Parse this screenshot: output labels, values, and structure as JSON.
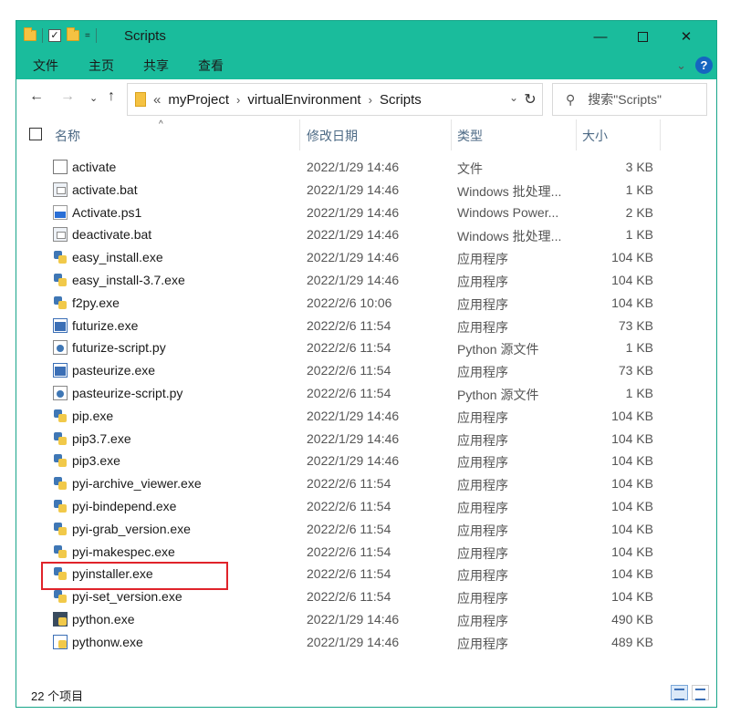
{
  "window": {
    "title": "Scripts",
    "colors": {
      "titlebar": "#1abc9c",
      "highlight": "#e0232a"
    }
  },
  "titlebar": {
    "quick_access": [
      "folder-icon",
      "check-icon",
      "folder-icon"
    ],
    "dropdown": "=",
    "minimize": "—",
    "close": "✕"
  },
  "ribbon": {
    "tabs": [
      {
        "label": "文件",
        "active": true
      },
      {
        "label": "主页"
      },
      {
        "label": "共享"
      },
      {
        "label": "查看"
      }
    ],
    "collapse": "⌄",
    "help": "?"
  },
  "nav": {
    "back": "←",
    "forward": "→",
    "recent": "⌄",
    "up": "↑",
    "breadcrumb_lead": "«",
    "breadcrumb": [
      "myProject",
      "virtualEnvironment",
      "Scripts"
    ],
    "chevron": "›",
    "dropdown": "⌄",
    "refresh": "↻",
    "search_icon": "⚲",
    "search_placeholder": "搜索\"Scripts\""
  },
  "columns": {
    "name": "名称",
    "modified": "修改日期",
    "type": "类型",
    "size": "大小",
    "sort_indicator": "^"
  },
  "files": [
    {
      "name": "activate",
      "date": "2022/1/29 14:46",
      "type": "文件",
      "size": "3 KB",
      "icon": "file"
    },
    {
      "name": "activate.bat",
      "date": "2022/1/29 14:46",
      "type": "Windows 批处理...",
      "size": "1 KB",
      "icon": "bat"
    },
    {
      "name": "Activate.ps1",
      "date": "2022/1/29 14:46",
      "type": "Windows Power...",
      "size": "2 KB",
      "icon": "ps1"
    },
    {
      "name": "deactivate.bat",
      "date": "2022/1/29 14:46",
      "type": "Windows 批处理...",
      "size": "1 KB",
      "icon": "bat"
    },
    {
      "name": "easy_install.exe",
      "date": "2022/1/29 14:46",
      "type": "应用程序",
      "size": "104 KB",
      "icon": "pyexe"
    },
    {
      "name": "easy_install-3.7.exe",
      "date": "2022/1/29 14:46",
      "type": "应用程序",
      "size": "104 KB",
      "icon": "pyexe"
    },
    {
      "name": "f2py.exe",
      "date": "2022/2/6 10:06",
      "type": "应用程序",
      "size": "104 KB",
      "icon": "pyexe"
    },
    {
      "name": "futurize.exe",
      "date": "2022/2/6 11:54",
      "type": "应用程序",
      "size": "73 KB",
      "icon": "win"
    },
    {
      "name": "futurize-script.py",
      "date": "2022/2/6 11:54",
      "type": "Python 源文件",
      "size": "1 KB",
      "icon": "py"
    },
    {
      "name": "pasteurize.exe",
      "date": "2022/2/6 11:54",
      "type": "应用程序",
      "size": "73 KB",
      "icon": "win"
    },
    {
      "name": "pasteurize-script.py",
      "date": "2022/2/6 11:54",
      "type": "Python 源文件",
      "size": "1 KB",
      "icon": "py"
    },
    {
      "name": "pip.exe",
      "date": "2022/1/29 14:46",
      "type": "应用程序",
      "size": "104 KB",
      "icon": "pyexe"
    },
    {
      "name": "pip3.7.exe",
      "date": "2022/1/29 14:46",
      "type": "应用程序",
      "size": "104 KB",
      "icon": "pyexe"
    },
    {
      "name": "pip3.exe",
      "date": "2022/1/29 14:46",
      "type": "应用程序",
      "size": "104 KB",
      "icon": "pyexe"
    },
    {
      "name": "pyi-archive_viewer.exe",
      "date": "2022/2/6 11:54",
      "type": "应用程序",
      "size": "104 KB",
      "icon": "pyexe"
    },
    {
      "name": "pyi-bindepend.exe",
      "date": "2022/2/6 11:54",
      "type": "应用程序",
      "size": "104 KB",
      "icon": "pyexe"
    },
    {
      "name": "pyi-grab_version.exe",
      "date": "2022/2/6 11:54",
      "type": "应用程序",
      "size": "104 KB",
      "icon": "pyexe"
    },
    {
      "name": "pyi-makespec.exe",
      "date": "2022/2/6 11:54",
      "type": "应用程序",
      "size": "104 KB",
      "icon": "pyexe"
    },
    {
      "name": "pyinstaller.exe",
      "date": "2022/2/6 11:54",
      "type": "应用程序",
      "size": "104 KB",
      "icon": "pyexe",
      "highlighted": true
    },
    {
      "name": "pyi-set_version.exe",
      "date": "2022/2/6 11:54",
      "type": "应用程序",
      "size": "104 KB",
      "icon": "pyexe"
    },
    {
      "name": "python.exe",
      "date": "2022/1/29 14:46",
      "type": "应用程序",
      "size": "490 KB",
      "icon": "dark"
    },
    {
      "name": "pythonw.exe",
      "date": "2022/1/29 14:46",
      "type": "应用程序",
      "size": "489 KB",
      "icon": "pyw"
    }
  ],
  "status": {
    "item_count": "22 个项目"
  }
}
